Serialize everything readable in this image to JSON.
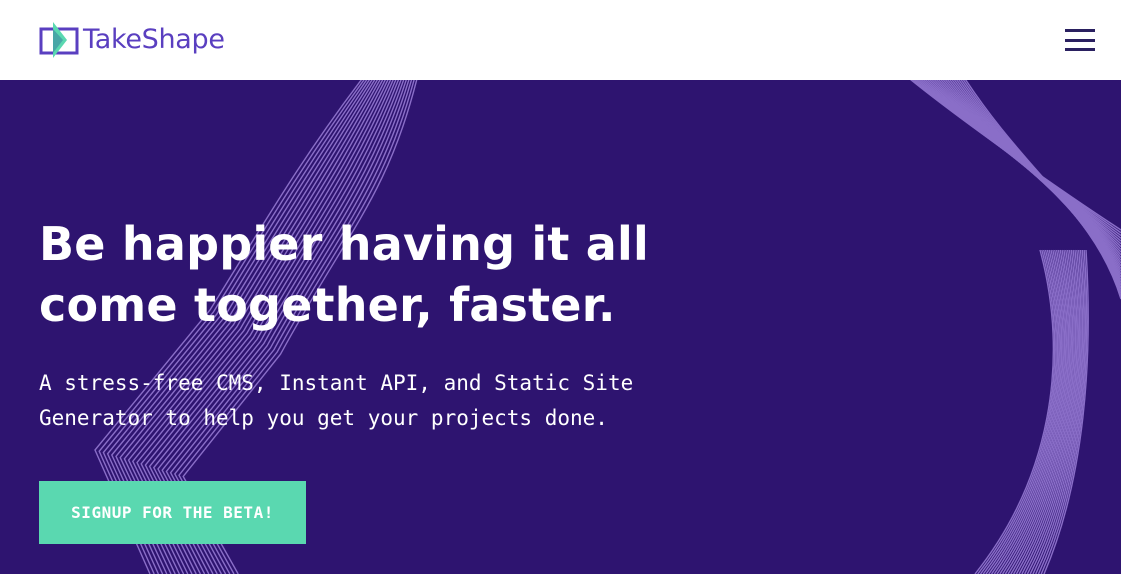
{
  "brand": {
    "logo_icon": "takeshape-logo-icon",
    "name": "TakeShape",
    "text_color": "#5a3fc0",
    "accent_green": "#5ad8b0"
  },
  "nav": {
    "menu_icon": "hamburger-menu-icon"
  },
  "hero": {
    "background_color": "#2e1470",
    "headline_lines": [
      "Be happier having it all",
      "come together, faster."
    ],
    "subtitle_lines": [
      "A stress-free CMS, Instant API, and Static Site",
      "Generator to help you get your projects done."
    ],
    "cta_label": "SIGNUP FOR THE BETA!"
  }
}
